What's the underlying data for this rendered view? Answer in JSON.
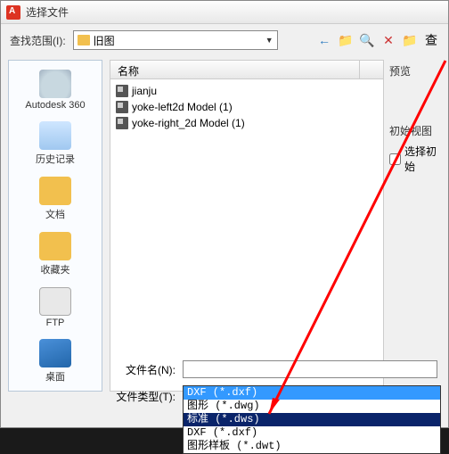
{
  "titlebar": {
    "title": "选择文件"
  },
  "toolbar": {
    "lookin_label": "查找范围(I):",
    "current_folder": "旧图"
  },
  "nav_icons": {
    "back": "←",
    "up": "📁",
    "search": "🔍",
    "delete": "✕",
    "new_folder": "📁",
    "views": "查"
  },
  "sidebar": {
    "items": [
      {
        "label": "Autodesk 360",
        "icon": "cloud"
      },
      {
        "label": "历史记录",
        "icon": "clock"
      },
      {
        "label": "文档",
        "icon": "folder"
      },
      {
        "label": "收藏夹",
        "icon": "folder"
      },
      {
        "label": "FTP",
        "icon": "ftp"
      },
      {
        "label": "桌面",
        "icon": "desktop"
      },
      {
        "label": "",
        "icon": "open-folder"
      }
    ]
  },
  "file_header": {
    "name_col": "名称"
  },
  "files": [
    {
      "name": "jianju"
    },
    {
      "name": "yoke-left2d Model (1)"
    },
    {
      "name": "yoke-right_2d Model (1)"
    }
  ],
  "rightpane": {
    "preview_label": "预览",
    "initview_label": "初始视图",
    "select_init_label": "选择初始"
  },
  "bottom": {
    "filename_label": "文件名(N):",
    "filetype_label": "文件类型(T):",
    "filename_value": ""
  },
  "filetype_options": [
    {
      "label": "DXF (*.dxf)",
      "state": "sel-blue"
    },
    {
      "label": "图形 (*.dwg)",
      "state": ""
    },
    {
      "label": "标准 (*.dws)",
      "state": "sel-dark"
    },
    {
      "label": "DXF (*.dxf)",
      "state": ""
    },
    {
      "label": "图形样板 (*.dwt)",
      "state": ""
    }
  ]
}
